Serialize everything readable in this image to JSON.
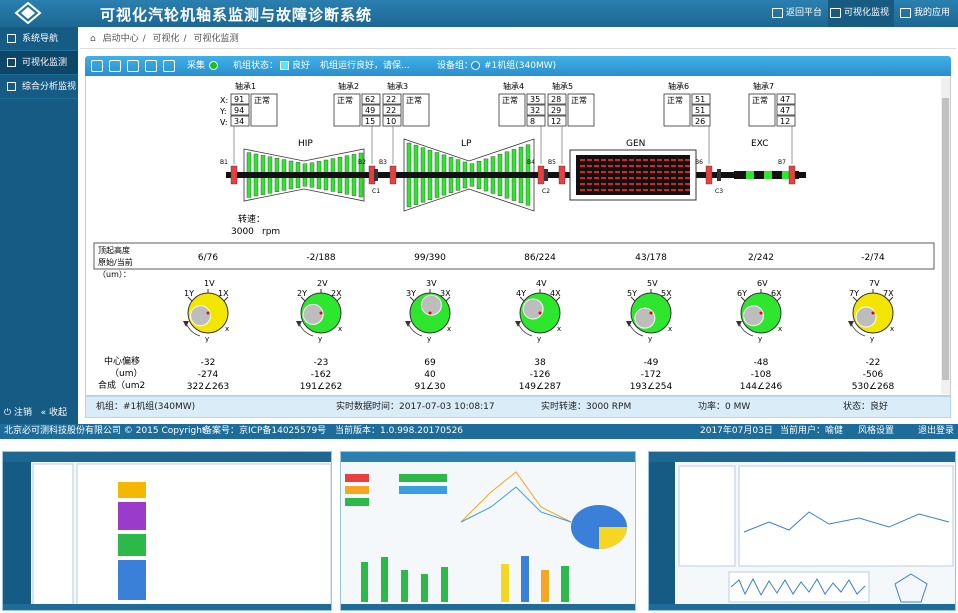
{
  "header": {
    "title": "可视化汽轮机轴系监测与故障诊断系统",
    "nav": [
      {
        "label": "返回平台"
      },
      {
        "label": "可视化监视"
      },
      {
        "label": "我的应用"
      }
    ]
  },
  "sidebar": {
    "items": [
      {
        "label": "系统导航"
      },
      {
        "label": "可视化监测"
      },
      {
        "label": "综合分析监视"
      }
    ],
    "logout": "注销",
    "collapse": "收起"
  },
  "breadcrumb": {
    "items": [
      "启动中心",
      "可视化",
      "可视化监测"
    ]
  },
  "toolbar": {
    "collect_label": "采集",
    "unit_state_label": "机组状态：",
    "state_value": "良好",
    "running_msg": "机组运行良好，请保...",
    "device_group_label": "设备组：",
    "device_group_value": "#1机组(340MW)"
  },
  "rotor": {
    "speed_label": "转速：",
    "speed_value": "3000",
    "speed_unit": "rpm",
    "sections": [
      "HIP",
      "LP",
      "GEN",
      "EXC"
    ],
    "bearing_labels": [
      "B1",
      "B2",
      "B3",
      "B4",
      "B5",
      "B6",
      "B7"
    ],
    "coupling_labels": [
      "C1",
      "C2",
      "C3"
    ],
    "axis_labels": [
      "X:",
      "Y:",
      "V:"
    ],
    "bearings": [
      {
        "name": "轴承1",
        "x": "91",
        "y": "94",
        "v": "34",
        "state": "正常"
      },
      {
        "name": "轴承2",
        "x": "62",
        "y": "49",
        "v": "15",
        "state": "正常"
      },
      {
        "name": "轴承3",
        "x": "22",
        "y": "22",
        "v": "10",
        "state": "正常"
      },
      {
        "name": "轴承4",
        "x": "35",
        "y": "32",
        "v": "8",
        "state": "正常"
      },
      {
        "name": "轴承5",
        "x": "28",
        "y": "29",
        "v": "12",
        "state": "正常"
      },
      {
        "name": "轴承6",
        "x": "51",
        "y": "51",
        "v": "26",
        "state": "正常"
      },
      {
        "name": "轴承7",
        "x": "47",
        "y": "47",
        "v": "12",
        "state": "正常"
      }
    ]
  },
  "jacking": {
    "label_line1": "顶起高度",
    "label_line2": "原始/当前",
    "unit": "（um）：",
    "values": [
      "6/76",
      "-2/188",
      "99/390",
      "86/224",
      "43/178",
      "2/242",
      "-2/74"
    ]
  },
  "orbits": {
    "items": [
      {
        "v": "1V",
        "y": "1Y",
        "x": "1X",
        "color": "#f2e600",
        "angle_deg": 200
      },
      {
        "v": "2V",
        "y": "2Y",
        "x": "2X",
        "color": "#2fe62f",
        "angle_deg": 190
      },
      {
        "v": "3V",
        "y": "3Y",
        "x": "3X",
        "color": "#2fe62f",
        "angle_deg": 80
      },
      {
        "v": "4V",
        "y": "4Y",
        "x": "4X",
        "color": "#2fe62f",
        "angle_deg": 150
      },
      {
        "v": "5V",
        "y": "5Y",
        "x": "5X",
        "color": "#2fe62f",
        "angle_deg": 220
      },
      {
        "v": "6V",
        "y": "6Y",
        "x": "6X",
        "color": "#2fe62f",
        "angle_deg": 200
      },
      {
        "v": "7V",
        "y": "7Y",
        "x": "7X",
        "color": "#f2e600",
        "angle_deg": 210
      }
    ],
    "axis_marks": {
      "x": "x",
      "y": "y"
    }
  },
  "offset": {
    "label1": "中心偏移",
    "label2": "（um）",
    "label3": "合成（um2",
    "row1": [
      "-32",
      "-23",
      "69",
      "38",
      "-49",
      "-48",
      "-22"
    ],
    "row2": [
      "-274",
      "-162",
      "40",
      "-126",
      "-172",
      "-108",
      "-506"
    ],
    "row3": [
      "322∠263",
      "191∠262",
      "91∠30",
      "149∠287",
      "193∠254",
      "144∠246",
      "530∠268"
    ]
  },
  "status": {
    "unit": "机组：#1机组(340MW)",
    "time": "实时数据时间：2017-07-03 10:08:17",
    "speed": "实时转速：3000 RPM",
    "power": "功率：0 MW",
    "state": "状态：良好"
  },
  "footer": {
    "company": "北京必可测科技股份有限公司 © 2015 Copyright",
    "icp": "备案号：京ICP备14025579号",
    "version": "当前版本：1.0.998.20170526",
    "date": "2017年07月03日",
    "user": "当前用户：喻健",
    "style": "风格设置",
    "exit": "退出登录"
  },
  "colors": {
    "header": "#1d6792",
    "sidebar": "#155b83",
    "green": "#2fe62f",
    "yellow": "#f2e600",
    "shaft": "#111111",
    "gen_red": "#e02020"
  }
}
